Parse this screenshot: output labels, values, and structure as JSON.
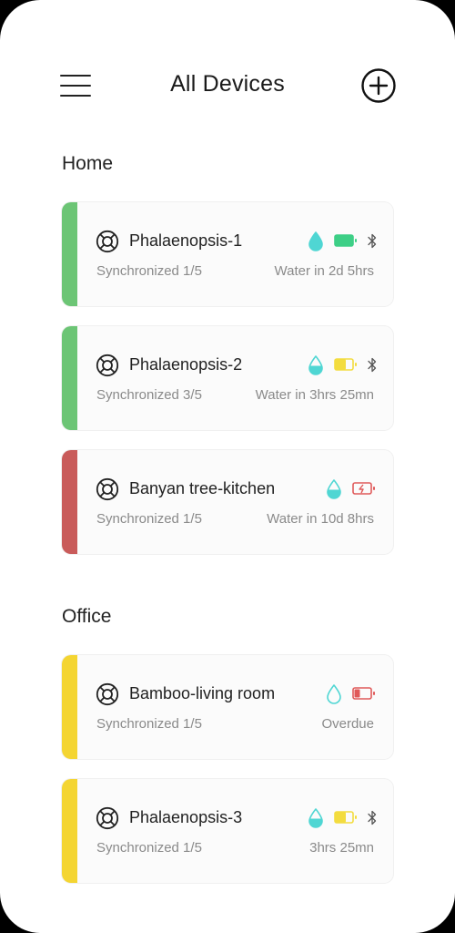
{
  "header": {
    "title": "All Devices"
  },
  "sections": [
    {
      "title": "Home",
      "devices": [
        {
          "name": "Phalaenopsis-1",
          "sync": "Synchronized 1/5",
          "water": "Water in 2d 5hrs",
          "status_color": "#6cc575",
          "drop": "filled",
          "battery": "full",
          "bluetooth": true
        },
        {
          "name": "Phalaenopsis-2",
          "sync": "Synchronized 3/5",
          "water": "Water in 3hrs 25mn",
          "status_color": "#6cc575",
          "drop": "half",
          "battery": "half",
          "bluetooth": true
        },
        {
          "name": "Banyan tree-kitchen",
          "sync": "Synchronized 1/5",
          "water": "Water in 10d 8hrs",
          "status_color": "#c95b5a",
          "drop": "half",
          "battery": "charging",
          "bluetooth": false
        }
      ]
    },
    {
      "title": "Office",
      "devices": [
        {
          "name": "Bamboo-living room",
          "sync": "Synchronized 1/5",
          "water": "Overdue",
          "status_color": "#f4d532",
          "drop": "empty",
          "battery": "low",
          "bluetooth": false
        },
        {
          "name": "Phalaenopsis-3",
          "sync": "Synchronized 1/5",
          "water": "3hrs 25mn",
          "status_color": "#f4d532",
          "drop": "half",
          "battery": "half",
          "bluetooth": true
        }
      ]
    }
  ],
  "colors": {
    "water": "#4fd6d3",
    "battery_full": "#3dcf86",
    "battery_half": "#f3dc3f",
    "battery_low": "#e05a5a"
  },
  "icons": {
    "menu": "hamburger-menu-icon",
    "add": "plus-circle-icon",
    "device": "lifebuoy-icon",
    "drop": "water-drop-icon",
    "battery": "battery-icon",
    "bluetooth": "bluetooth-icon"
  }
}
